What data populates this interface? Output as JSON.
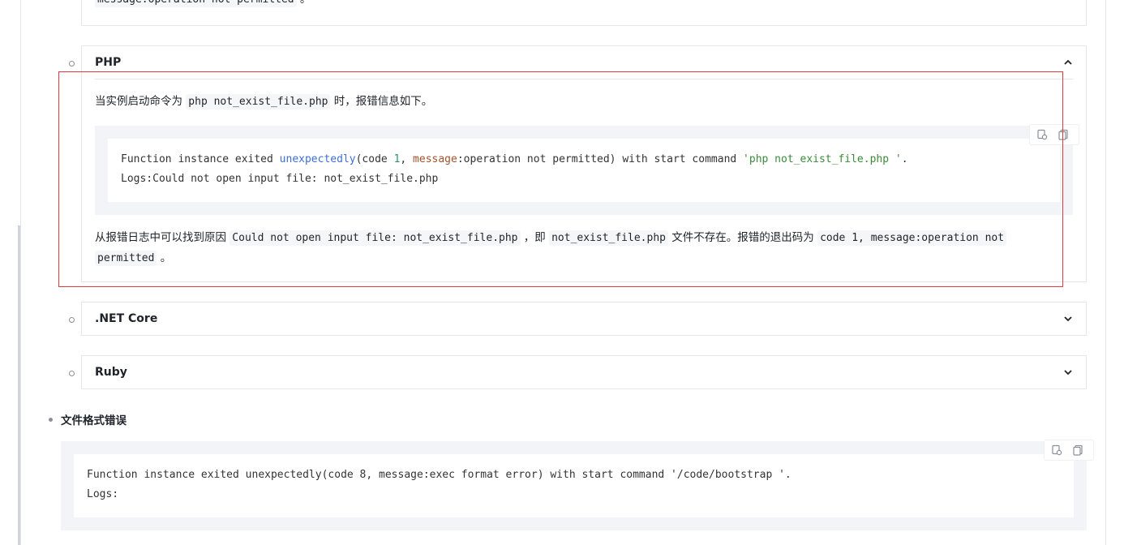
{
  "top_fragment": {
    "code": "message:operation not permitted",
    "suffix": " 。"
  },
  "php_panel": {
    "title": "PHP",
    "intro_prefix": "当实例启动命令为 ",
    "intro_code": "php not_exist_file.php",
    "intro_suffix": " 时，报错信息如下。",
    "code_line1": {
      "t1": "Function instance exited ",
      "func": "unexpectedly",
      "t2": "(code ",
      "num": "1",
      "t3": ", ",
      "key": "message",
      "t4": ":operation not permitted) with start command ",
      "str": "'php not_exist_file.php '",
      "t5": "."
    },
    "code_line2": "Logs:Could not open input file: not_exist_file.php",
    "conclusion": {
      "p1": "从报错日志中可以找到原因 ",
      "c1": "Could not open input file: not_exist_file.php",
      "p2": " ，即 ",
      "c2": "not_exist_file.php",
      "p3": " 文件不存在。报错的退出码为 ",
      "c3": "code 1, message:operation not",
      "c4": "permitted",
      "p4": " 。"
    }
  },
  "collapsed_panels": [
    {
      "title": ".NET Core"
    },
    {
      "title": "Ruby"
    }
  ],
  "file_format_section": {
    "heading": "文件格式错误",
    "code_line1": "Function instance exited unexpectedly(code 8, message:exec format error) with start command '/code/bootstrap '.",
    "code_line2": "Logs:"
  },
  "icons": {
    "copy_to_editor": "copy-edit-icon",
    "copy": "copy-icon",
    "expand": "chevron-down-icon",
    "collapse": "chevron-up-icon"
  },
  "colors": {
    "highlight_border": "#e23b3b",
    "code_bg": "#f2f4f7"
  }
}
